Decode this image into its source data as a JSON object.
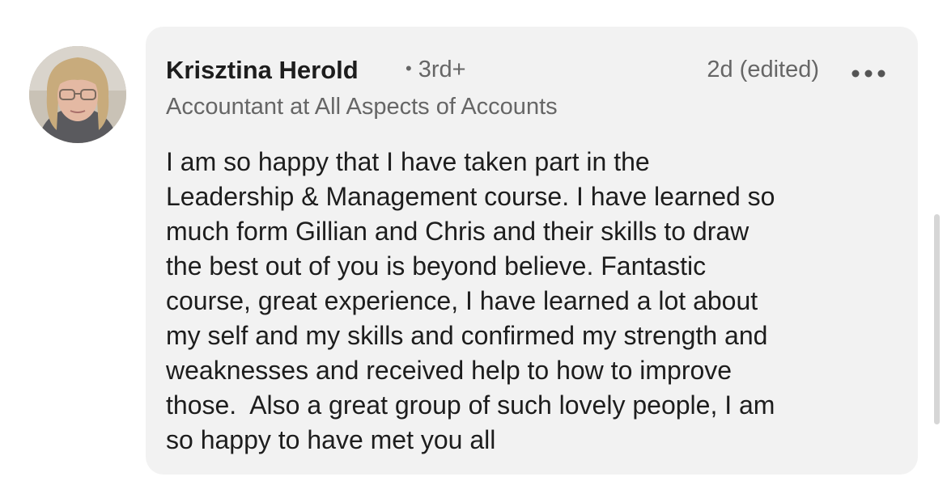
{
  "comment": {
    "author": {
      "name": "Krisztina Herold",
      "degree": "3rd+",
      "headline": "Accountant at All Aspects of Accounts",
      "avatar_icon": "profile-photo"
    },
    "timestamp": "2d (edited)",
    "more_icon": "more-horizontal-icon",
    "body_lines": [
      "I am so happy that I have taken part in the",
      "Leadership & Management course. I have learned so",
      "much form Gillian and Chris and their skills to draw",
      "the best out of you is beyond believe. Fantastic",
      "course, great experience, I have learned a lot about",
      "my self and my skills and confirmed my strength and",
      "weaknesses and received help to how to improve",
      "those.  Also a great group of such lovely people, I am",
      "so happy to have met you all"
    ]
  },
  "colors": {
    "bubble_background": "#f2f2f2",
    "primary_text": "#1d1d1d",
    "secondary_text": "#666666"
  }
}
